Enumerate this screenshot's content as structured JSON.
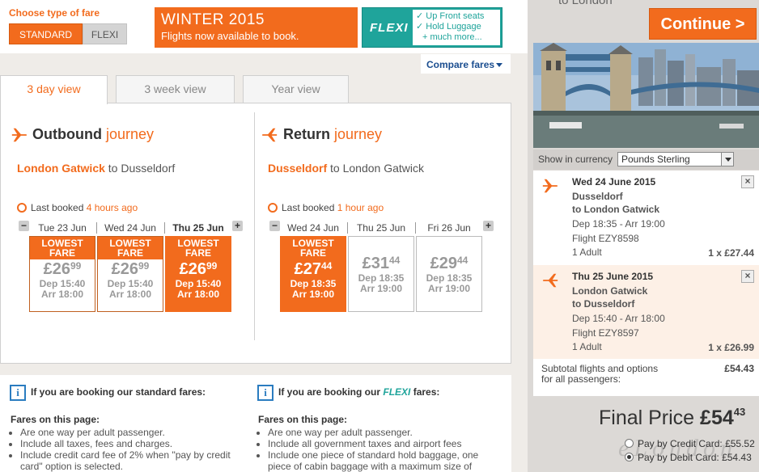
{
  "fare_type": {
    "label": "Choose type of fare",
    "standard": "STANDARD",
    "flexi": "FLEXI"
  },
  "winter_banner": {
    "title": "WINTER 2015",
    "subtitle": "Flights now available to book."
  },
  "flexi_banner": {
    "logo": "FLEXI",
    "perks": [
      "✓ Up Front seats",
      "✓ Hold Luggage",
      "+ much more..."
    ]
  },
  "compare_fares": "Compare fares",
  "tabs": [
    "3 day view",
    "3 week view",
    "Year view"
  ],
  "outbound": {
    "heading_bold": "Outbound",
    "heading_light": "journey",
    "route_from": "London Gatwick",
    "route_rest": "to Dusseldorf",
    "last_booked_label": "Last booked",
    "last_booked_value": "4 hours ago",
    "days": [
      {
        "header": "Tue 23 Jun",
        "lowest": "LOWEST FARE",
        "pounds": "£26",
        "pence": "99",
        "dep": "Dep 15:40",
        "arr": "Arr 18:00"
      },
      {
        "header": "Wed 24 Jun",
        "lowest": "LOWEST FARE",
        "pounds": "£26",
        "pence": "99",
        "dep": "Dep 15:40",
        "arr": "Arr 18:00"
      },
      {
        "header": "Thu 25 Jun",
        "lowest": "LOWEST FARE",
        "pounds": "£26",
        "pence": "99",
        "dep": "Dep 15:40",
        "arr": "Arr 18:00"
      }
    ]
  },
  "return": {
    "heading_bold": "Return",
    "heading_light": "journey",
    "route_from": "Dusseldorf",
    "route_rest": "to London Gatwick",
    "last_booked_label": "Last booked",
    "last_booked_value": "1 hour ago",
    "days": [
      {
        "header": "Wed 24 Jun",
        "lowest": "LOWEST FARE",
        "pounds": "£27",
        "pence": "44",
        "dep": "Dep 18:35",
        "arr": "Arr 19:00"
      },
      {
        "header": "Thu 25 Jun",
        "pounds": "£31",
        "pence": "44",
        "dep": "Dep 18:35",
        "arr": "Arr 19:00"
      },
      {
        "header": "Fri 26 Jun",
        "pounds": "£29",
        "pence": "44",
        "dep": "Dep 18:35",
        "arr": "Arr 19:00"
      }
    ]
  },
  "info": {
    "standard": {
      "title": "If you are booking our standard fares:",
      "sub": "Fares on this page:",
      "items": [
        "Are one way per adult passenger.",
        "Include all taxes, fees and charges.",
        "Include credit card fee of 2% when \"pay by credit card\" option is selected."
      ]
    },
    "flexi": {
      "title_a": "If you are booking our",
      "title_flexi": "FLEXI",
      "title_b": "fares:",
      "sub": "Fares on this page:",
      "items": [
        "Are one way per adult passenger.",
        "Include all government taxes and airport fees",
        "Include one piece of standard hold baggage, one piece of cabin baggage with a maximum size of"
      ]
    }
  },
  "sidebar": {
    "to_london": "to London",
    "continue": "Continue >",
    "currency_label": "Show in currency",
    "currency_value": "Pounds Sterling",
    "flights": [
      {
        "date": "Wed 24 June 2015",
        "from": "Dusseldorf",
        "to": "to London Gatwick",
        "times": "Dep 18:35 - Arr 19:00",
        "flight": "Flight EZY8598",
        "adult": "1 Adult",
        "price": "1 x £27.44"
      },
      {
        "date": "Thu 25 June 2015",
        "from": "London Gatwick",
        "to": "to Dusseldorf",
        "times": "Dep 15:40 - Arr 18:00",
        "flight": "Flight EZY8597",
        "adult": "1 Adult",
        "price": "1 x £26.99"
      }
    ],
    "subtotal_line1": "Subtotal flights and options",
    "subtotal_line2": "for all passengers:",
    "subtotal_amount": "£54.43",
    "final_label": "Final Price",
    "final_pounds": "£54",
    "final_pence": "43",
    "pay_credit_label": "Pay by Credit Card:",
    "pay_credit_amount": "£55.52",
    "pay_debit_label": "Pay by Debit Card:",
    "pay_debit_amount": "£54.43",
    "watermark": "eLondon"
  },
  "colors": {
    "brand_orange": "#f26b1d",
    "flexi_teal": "#1fa49b",
    "link_blue": "#1a4d8f"
  }
}
